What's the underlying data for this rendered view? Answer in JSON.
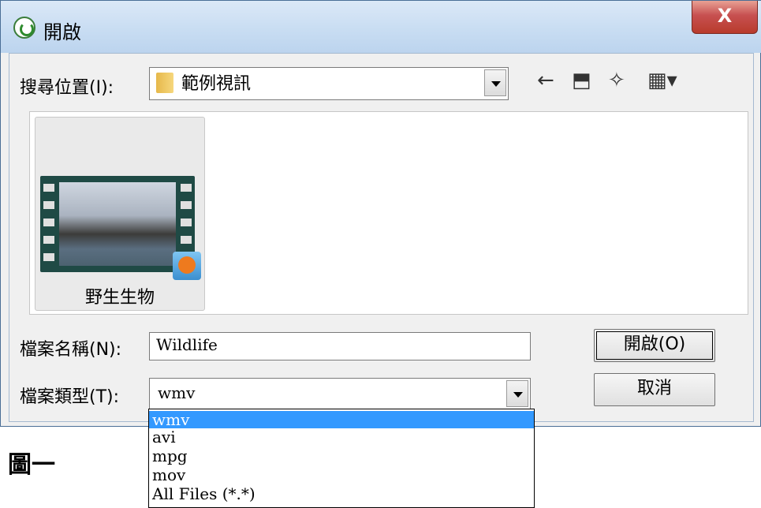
{
  "window": {
    "title": "開啟",
    "close_label": "X"
  },
  "look_in": {
    "label": "搜尋位置(I):",
    "value": "範例視訊"
  },
  "toolbar": {
    "back_icon": "←",
    "up_folder_icon": "⬒",
    "new_folder_icon": "✧",
    "view_menu_icon": "▦▾"
  },
  "files": [
    {
      "name": "野生生物",
      "icon": "video-thumbnail"
    }
  ],
  "filename": {
    "label": "檔案名稱(N):",
    "value": "Wildlife"
  },
  "filetype": {
    "label": "檔案類型(T):",
    "value": "wmv",
    "options": [
      "wmv",
      "avi",
      "mpg",
      "mov",
      "All Files (*.*)"
    ]
  },
  "buttons": {
    "open": "開啟(O)",
    "cancel": "取消"
  },
  "figure_caption": "圖一"
}
